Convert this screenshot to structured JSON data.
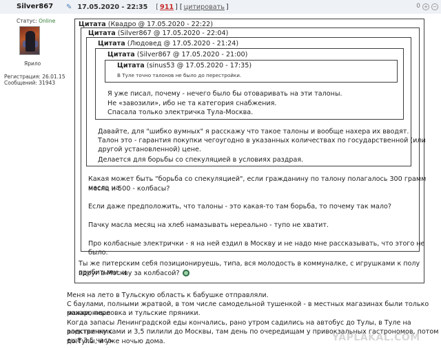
{
  "post": {
    "username": "Silver867",
    "pin_icon": "pin-icon",
    "date": "17.05.2020 - 22:35",
    "rating_open": "[",
    "rating": "911",
    "rating_close": "]",
    "quote_open": "[",
    "quote_label": "цитировать",
    "quote_close": "]",
    "score": "0"
  },
  "user": {
    "status_label": "Статус:",
    "status_value": "Online",
    "rank": "Ярило",
    "registration": "Регистрация: 26.01.15",
    "messages": "Сообщений: 31943"
  },
  "quotes": [
    {
      "word": "Цитата",
      "meta": "(Квадро @ 17.05.2020 - 22:22)"
    },
    {
      "word": "Цитата",
      "meta": "(Silver867 @ 17.05.2020 - 22:04)"
    },
    {
      "word": "Цитата",
      "meta": "(Людовед @ 17.05.2020 - 21:24)"
    },
    {
      "word": "Цитата",
      "meta": "(Silver867 @ 17.05.2020 - 21:00)"
    },
    {
      "word": "Цитата",
      "meta": "(sinus53 @ 17.05.2020 - 17:35)"
    }
  ],
  "q5_text": "В Туле точно талонов не было до перестройки.",
  "q4_text": [
    "Я уже писал, почему - нечего было бы отоваривать на эти талоны.",
    "Не «завозили», ибо не та категория снабжения.",
    "Спасала только электричка Тула-Москва."
  ],
  "q3_text": [
    "Давайте, для \"шибко вумных\" я расскажу что такое талоны и вообще нахера их вводят.",
    "Талон это - гарантия покупки чегоугодно в указанных количествах по государственной (или",
    "другой установленной) цене.",
    "Делается для борьбы со спекуляцией в условиях раздрая."
  ],
  "q2_text": [
    "Какая может быть \"борьба со спекуляцией\", если гражданину по талону полагалось 300 грамм масла на",
    "месяц и 500 - колбасы?",
    "Если даже предположить, что талоны - это какая-то там борьба, то почему так мало?",
    "Пачку масла месяц на хлеб намазывать нереально - тупо не хватит.",
    "Про колбасные электрички - я на ней ездил в Москву и не надо мне рассказывать, что этого не было."
  ],
  "q1_text": [
    "Ты же питерским себя позиционируешь, типа, вся молодость в коммуналке, с игрушками к полу прибитыми, и",
    "вдруг в Москву за колбасой?"
  ],
  "body_text": [
    "Меня на лето в Тульскую область к бабушке отправляли.",
    "С баулами, полными жратвой, в том числе самодельной тушенкой - в местных магазинах были только макаронные",
    "рожки, перловка и тульские пряники.",
    "Когда запасы Ленинградской еды кончались, рано утром садились на автобус до Тулы, в Туле на электричку с",
    "родственниками и 3,5 пилили до Москвы, там день по очередищам у привокзальных гастрономов, потом ещё 3,5 часа",
    "до Тулы, и уже ночью дома."
  ],
  "watermark": "YAPLAKAL.COM",
  "colors": {
    "bar_bg": "#eef1f5",
    "rating": "#c62828",
    "online": "#2e7d32",
    "border": "#3c3c3c"
  }
}
